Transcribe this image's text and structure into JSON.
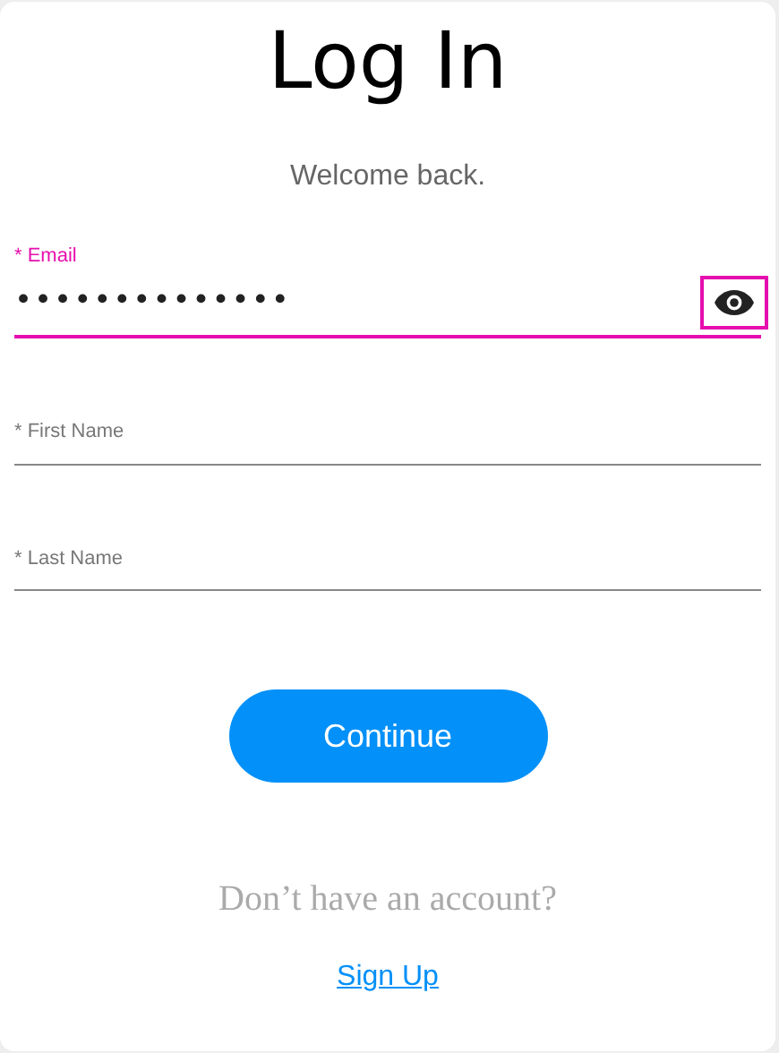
{
  "title": "Log In",
  "subtitle": "Welcome back.",
  "fields": [
    {
      "label": "* Email",
      "value": "••••••••••••••",
      "focused": true,
      "kind": "password"
    },
    {
      "placeholder": "* First Name",
      "focused": false,
      "kind": "text"
    },
    {
      "placeholder": "* Last Name",
      "focused": false,
      "kind": "text"
    }
  ],
  "continue_button": "Continue",
  "prompt": "Don’t have an account?",
  "signup_link": "Sign Up"
}
